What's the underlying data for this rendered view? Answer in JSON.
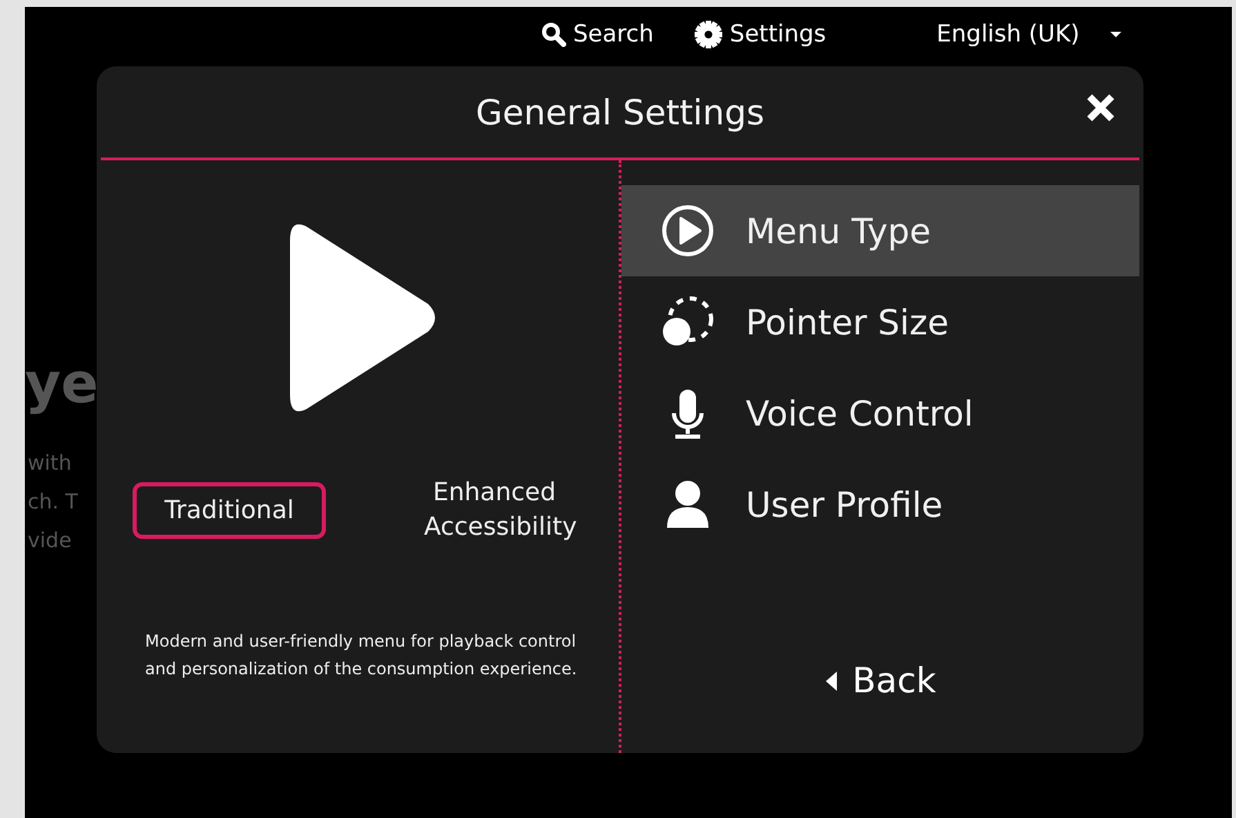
{
  "topbar": {
    "search": "Search",
    "settings": "Settings",
    "language": "English (UK)"
  },
  "background_text": [
    "ye",
    "with",
    "ch. T",
    "vide"
  ],
  "dialog": {
    "title": "General Settings",
    "menu_types": [
      {
        "label": "Traditional",
        "selected": true
      },
      {
        "label": "Enhanced Accessibility",
        "selected": false
      }
    ],
    "description": "Modern and user-friendly menu for playback control and personalization of the consumption experience.",
    "menu": [
      {
        "label": "Menu Type",
        "kind": "play",
        "selected": true
      },
      {
        "label": "Pointer Size",
        "kind": "pointer",
        "selected": false
      },
      {
        "label": "Voice Control",
        "kind": "mic",
        "selected": false
      },
      {
        "label": "User Profile",
        "kind": "user",
        "selected": false
      }
    ],
    "back": "Back"
  }
}
